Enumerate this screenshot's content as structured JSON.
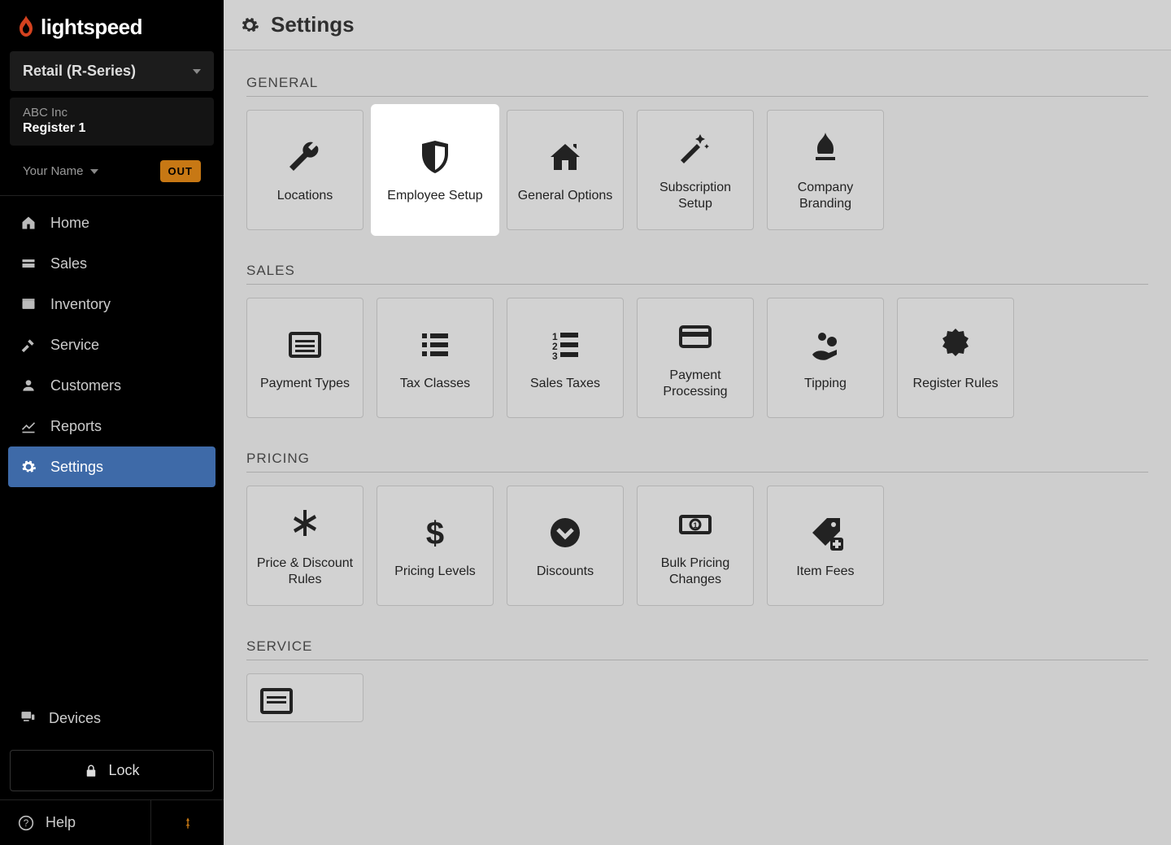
{
  "brand": {
    "name": "lightspeed"
  },
  "sidebar": {
    "product_selector": "Retail (R-Series)",
    "company": "ABC Inc",
    "register": "Register 1",
    "user": "Your Name",
    "out_badge": "OUT",
    "nav": [
      {
        "key": "home",
        "label": "Home",
        "icon": "home-icon"
      },
      {
        "key": "sales",
        "label": "Sales",
        "icon": "tag-icon"
      },
      {
        "key": "inventory",
        "label": "Inventory",
        "icon": "box-icon"
      },
      {
        "key": "service",
        "label": "Service",
        "icon": "hammer-icon"
      },
      {
        "key": "customers",
        "label": "Customers",
        "icon": "user-icon"
      },
      {
        "key": "reports",
        "label": "Reports",
        "icon": "chart-icon"
      },
      {
        "key": "settings",
        "label": "Settings",
        "icon": "gear-icon",
        "active": true
      }
    ],
    "devices": "Devices",
    "lock": "Lock",
    "help": "Help"
  },
  "page": {
    "title": "Settings",
    "sections": [
      {
        "key": "general",
        "title": "GENERAL",
        "tiles": [
          {
            "key": "locations",
            "label": "Locations",
            "icon": "wrench-icon"
          },
          {
            "key": "employee-setup",
            "label": "Employee Setup",
            "icon": "shield-icon",
            "highlight": true
          },
          {
            "key": "general-options",
            "label": "General Options",
            "icon": "house-icon"
          },
          {
            "key": "subscription-setup",
            "label": "Subscription Setup",
            "icon": "wand-icon"
          },
          {
            "key": "company-branding",
            "label": "Company Branding",
            "icon": "flame2-icon"
          }
        ]
      },
      {
        "key": "sales",
        "title": "SALES",
        "tiles": [
          {
            "key": "payment-types",
            "label": "Payment Types",
            "icon": "list-card-icon"
          },
          {
            "key": "tax-classes",
            "label": "Tax Classes",
            "icon": "lines-icon"
          },
          {
            "key": "sales-taxes",
            "label": "Sales Taxes",
            "icon": "numlist-icon"
          },
          {
            "key": "payment-processing",
            "label": "Payment Processing",
            "icon": "card-icon"
          },
          {
            "key": "tipping",
            "label": "Tipping",
            "icon": "tip-icon"
          },
          {
            "key": "register-rules",
            "label": "Register Rules",
            "icon": "seal-icon"
          }
        ]
      },
      {
        "key": "pricing",
        "title": "PRICING",
        "tiles": [
          {
            "key": "price-discount-rules",
            "label": "Price & Discount Rules",
            "icon": "asterisk-icon"
          },
          {
            "key": "pricing-levels",
            "label": "Pricing Levels",
            "icon": "dollar-icon"
          },
          {
            "key": "discounts",
            "label": "Discounts",
            "icon": "chevron-circle-icon"
          },
          {
            "key": "bulk-pricing",
            "label": "Bulk Pricing Changes",
            "icon": "money-icon"
          },
          {
            "key": "item-fees",
            "label": "Item Fees",
            "icon": "pricetag-plus-icon"
          }
        ]
      },
      {
        "key": "service",
        "title": "SERVICE",
        "tiles": [
          {
            "key": "service-placeholder",
            "label": "",
            "icon": "list-card-icon"
          }
        ]
      }
    ]
  }
}
